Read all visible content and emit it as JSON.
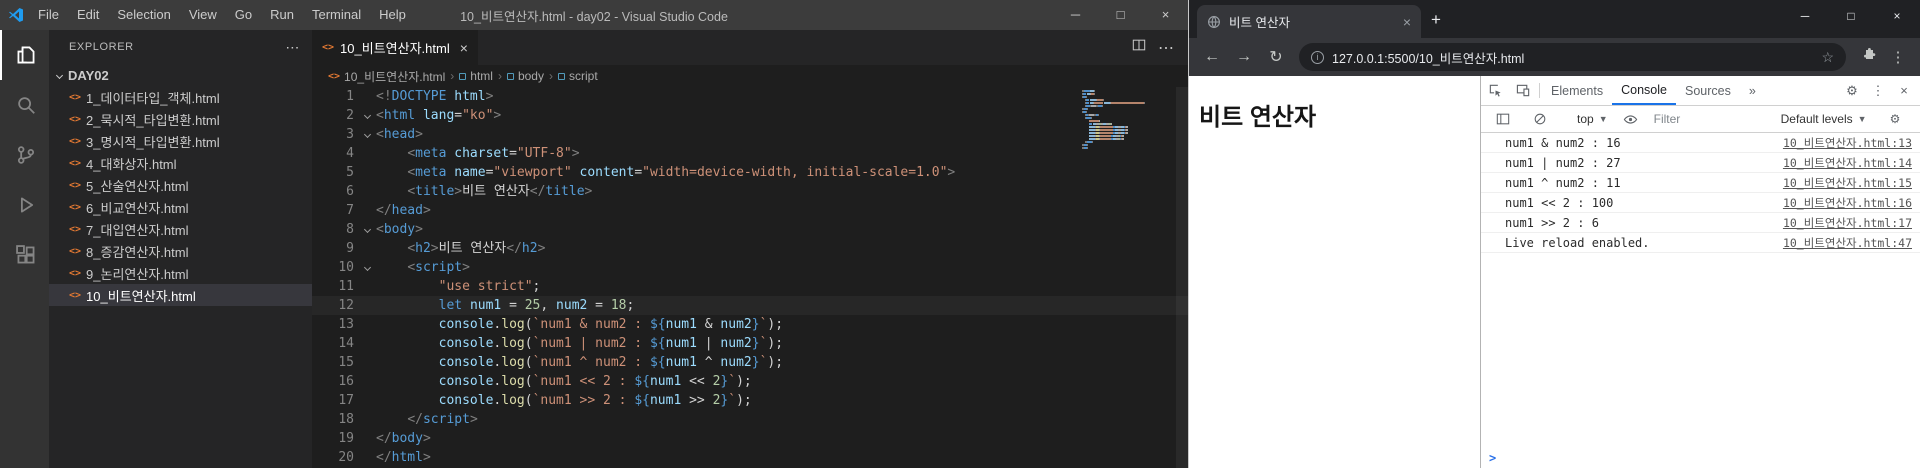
{
  "colors": {
    "vscode_accent": "#569cd6",
    "html_icon_orange": "#e37933",
    "string_orange": "#ce9178",
    "number_green": "#b5cea8",
    "devtools_accent": "#1a73e8"
  },
  "vscode": {
    "title": "10_비트연산자.html - day02 - Visual Studio Code",
    "menus": [
      "File",
      "Edit",
      "Selection",
      "View",
      "Go",
      "Run",
      "Terminal",
      "Help"
    ],
    "explorer": {
      "header": "EXPLORER",
      "folder": "DAY02",
      "files": [
        {
          "name": "1_데이터타입_객체.html",
          "selected": false
        },
        {
          "name": "2_묵시적_타입변환.html",
          "selected": false
        },
        {
          "name": "3_명시적_타입변환.html",
          "selected": false
        },
        {
          "name": "4_대화상자.html",
          "selected": false
        },
        {
          "name": "5_산술연산자.html",
          "selected": false
        },
        {
          "name": "6_비교연산자.html",
          "selected": false
        },
        {
          "name": "7_대입연산자.html",
          "selected": false
        },
        {
          "name": "8_증감연산자.html",
          "selected": false
        },
        {
          "name": "9_논리연산자.html",
          "selected": false
        },
        {
          "name": "10_비트연산자.html",
          "selected": true
        }
      ]
    },
    "tab": {
      "label": "10_비트연산자.html"
    },
    "breadcrumb": [
      "10_비트연산자.html",
      "html",
      "body",
      "script"
    ],
    "code_lines": [
      {
        "n": 1,
        "fold": false,
        "current": false,
        "tokens": [
          [
            "p",
            "<!"
          ],
          [
            "k",
            "DOCTYPE"
          ],
          [
            "a",
            " html"
          ],
          [
            "p",
            ">"
          ]
        ]
      },
      {
        "n": 2,
        "fold": true,
        "current": false,
        "tokens": [
          [
            "p",
            "<"
          ],
          [
            "t",
            "html"
          ],
          [
            "w",
            " "
          ],
          [
            "a",
            "lang"
          ],
          [
            "w",
            "="
          ],
          [
            "s",
            "\"ko\""
          ],
          [
            "p",
            ">"
          ]
        ]
      },
      {
        "n": 3,
        "fold": true,
        "current": false,
        "tokens": [
          [
            "p",
            "<"
          ],
          [
            "t",
            "head"
          ],
          [
            "p",
            ">"
          ]
        ]
      },
      {
        "n": 4,
        "fold": false,
        "current": false,
        "tokens": [
          [
            "w",
            "    "
          ],
          [
            "p",
            "<"
          ],
          [
            "t",
            "meta"
          ],
          [
            "w",
            " "
          ],
          [
            "a",
            "charset"
          ],
          [
            "w",
            "="
          ],
          [
            "s",
            "\"UTF-8\""
          ],
          [
            "p",
            ">"
          ]
        ]
      },
      {
        "n": 5,
        "fold": false,
        "current": false,
        "tokens": [
          [
            "w",
            "    "
          ],
          [
            "p",
            "<"
          ],
          [
            "t",
            "meta"
          ],
          [
            "w",
            " "
          ],
          [
            "a",
            "name"
          ],
          [
            "w",
            "="
          ],
          [
            "s",
            "\"viewport\""
          ],
          [
            "w",
            " "
          ],
          [
            "a",
            "content"
          ],
          [
            "w",
            "="
          ],
          [
            "s",
            "\"width=device-width, initial-scale=1.0\""
          ],
          [
            "p",
            ">"
          ]
        ]
      },
      {
        "n": 6,
        "fold": false,
        "current": false,
        "tokens": [
          [
            "w",
            "    "
          ],
          [
            "p",
            "<"
          ],
          [
            "t",
            "title"
          ],
          [
            "p",
            ">"
          ],
          [
            "w",
            "비트 연산자"
          ],
          [
            "p",
            "</"
          ],
          [
            "t",
            "title"
          ],
          [
            "p",
            ">"
          ]
        ]
      },
      {
        "n": 7,
        "fold": false,
        "current": false,
        "tokens": [
          [
            "p",
            "</"
          ],
          [
            "t",
            "head"
          ],
          [
            "p",
            ">"
          ]
        ]
      },
      {
        "n": 8,
        "fold": true,
        "current": false,
        "tokens": [
          [
            "p",
            "<"
          ],
          [
            "t",
            "body"
          ],
          [
            "p",
            ">"
          ]
        ]
      },
      {
        "n": 9,
        "fold": false,
        "current": false,
        "tokens": [
          [
            "w",
            "    "
          ],
          [
            "p",
            "<"
          ],
          [
            "t",
            "h2"
          ],
          [
            "p",
            ">"
          ],
          [
            "w",
            "비트 연산자"
          ],
          [
            "p",
            "</"
          ],
          [
            "t",
            "h2"
          ],
          [
            "p",
            ">"
          ]
        ]
      },
      {
        "n": 10,
        "fold": true,
        "current": false,
        "tokens": [
          [
            "w",
            "    "
          ],
          [
            "p",
            "<"
          ],
          [
            "t",
            "script"
          ],
          [
            "p",
            ">"
          ]
        ]
      },
      {
        "n": 11,
        "fold": false,
        "current": false,
        "tokens": [
          [
            "w",
            "        "
          ],
          [
            "s",
            "\"use strict\""
          ],
          [
            "w",
            ";"
          ]
        ]
      },
      {
        "n": 12,
        "fold": false,
        "current": true,
        "tokens": [
          [
            "w",
            "        "
          ],
          [
            "k",
            "let"
          ],
          [
            "w",
            " "
          ],
          [
            "v",
            "num1"
          ],
          [
            "w",
            " = "
          ],
          [
            "n",
            "25"
          ],
          [
            "w",
            ", "
          ],
          [
            "v",
            "num2"
          ],
          [
            "w",
            " = "
          ],
          [
            "n",
            "18"
          ],
          [
            "w",
            ";"
          ]
        ]
      },
      {
        "n": 13,
        "fold": false,
        "current": false,
        "tokens": [
          [
            "w",
            "        "
          ],
          [
            "v",
            "console"
          ],
          [
            "w",
            "."
          ],
          [
            "f",
            "log"
          ],
          [
            "w",
            "("
          ],
          [
            "s",
            "`num1 & num2 : "
          ],
          [
            "i",
            "${"
          ],
          [
            "v",
            "num1"
          ],
          [
            "w",
            " & "
          ],
          [
            "v",
            "num2"
          ],
          [
            "i",
            "}"
          ],
          [
            "s",
            "`"
          ],
          [
            "w",
            ");"
          ]
        ]
      },
      {
        "n": 14,
        "fold": false,
        "current": false,
        "tokens": [
          [
            "w",
            "        "
          ],
          [
            "v",
            "console"
          ],
          [
            "w",
            "."
          ],
          [
            "f",
            "log"
          ],
          [
            "w",
            "("
          ],
          [
            "s",
            "`num1 | num2 : "
          ],
          [
            "i",
            "${"
          ],
          [
            "v",
            "num1"
          ],
          [
            "w",
            " | "
          ],
          [
            "v",
            "num2"
          ],
          [
            "i",
            "}"
          ],
          [
            "s",
            "`"
          ],
          [
            "w",
            ");"
          ]
        ]
      },
      {
        "n": 15,
        "fold": false,
        "current": false,
        "tokens": [
          [
            "w",
            "        "
          ],
          [
            "v",
            "console"
          ],
          [
            "w",
            "."
          ],
          [
            "f",
            "log"
          ],
          [
            "w",
            "("
          ],
          [
            "s",
            "`num1 ^ num2 : "
          ],
          [
            "i",
            "${"
          ],
          [
            "v",
            "num1"
          ],
          [
            "w",
            " ^ "
          ],
          [
            "v",
            "num2"
          ],
          [
            "i",
            "}"
          ],
          [
            "s",
            "`"
          ],
          [
            "w",
            ");"
          ]
        ]
      },
      {
        "n": 16,
        "fold": false,
        "current": false,
        "tokens": [
          [
            "w",
            "        "
          ],
          [
            "v",
            "console"
          ],
          [
            "w",
            "."
          ],
          [
            "f",
            "log"
          ],
          [
            "w",
            "("
          ],
          [
            "s",
            "`num1 << 2 : "
          ],
          [
            "i",
            "${"
          ],
          [
            "v",
            "num1"
          ],
          [
            "w",
            " << "
          ],
          [
            "n",
            "2"
          ],
          [
            "i",
            "}"
          ],
          [
            "s",
            "`"
          ],
          [
            "w",
            ");"
          ]
        ]
      },
      {
        "n": 17,
        "fold": false,
        "current": false,
        "tokens": [
          [
            "w",
            "        "
          ],
          [
            "v",
            "console"
          ],
          [
            "w",
            "."
          ],
          [
            "f",
            "log"
          ],
          [
            "w",
            "("
          ],
          [
            "s",
            "`num1 >> 2 : "
          ],
          [
            "i",
            "${"
          ],
          [
            "v",
            "num1"
          ],
          [
            "w",
            " >> "
          ],
          [
            "n",
            "2"
          ],
          [
            "i",
            "}"
          ],
          [
            "s",
            "`"
          ],
          [
            "w",
            ");"
          ]
        ]
      },
      {
        "n": 18,
        "fold": false,
        "current": false,
        "tokens": [
          [
            "w",
            "    "
          ],
          [
            "p",
            "</"
          ],
          [
            "t",
            "script"
          ],
          [
            "p",
            ">"
          ]
        ]
      },
      {
        "n": 19,
        "fold": false,
        "current": false,
        "tokens": [
          [
            "p",
            "</"
          ],
          [
            "t",
            "body"
          ],
          [
            "p",
            ">"
          ]
        ]
      },
      {
        "n": 20,
        "fold": false,
        "current": false,
        "tokens": [
          [
            "p",
            "</"
          ],
          [
            "t",
            "html"
          ],
          [
            "p",
            ">"
          ]
        ]
      }
    ]
  },
  "chrome": {
    "tab_title": "비트 연산자",
    "url": "127.0.0.1:5500/10_비트연산자.html",
    "page_heading": "비트 연산자",
    "devtools": {
      "tabs": [
        "Elements",
        "Console",
        "Sources"
      ],
      "active_tab": "Console",
      "context_selector": "top",
      "filter_placeholder": "Filter",
      "level_selector": "Default levels",
      "messages": [
        {
          "text": "num1 & num2 : 16",
          "source": "10_비트연산자.html:13"
        },
        {
          "text": "num1 | num2 : 27",
          "source": "10_비트연산자.html:14"
        },
        {
          "text": "num1 ^ num2 : 11",
          "source": "10_비트연산자.html:15"
        },
        {
          "text": "num1 << 2 : 100",
          "source": "10_비트연산자.html:16"
        },
        {
          "text": "num1 >> 2 : 6",
          "source": "10_비트연산자.html:17"
        },
        {
          "text": "Live reload enabled.",
          "source": "10_비트연산자.html:47"
        }
      ]
    }
  }
}
